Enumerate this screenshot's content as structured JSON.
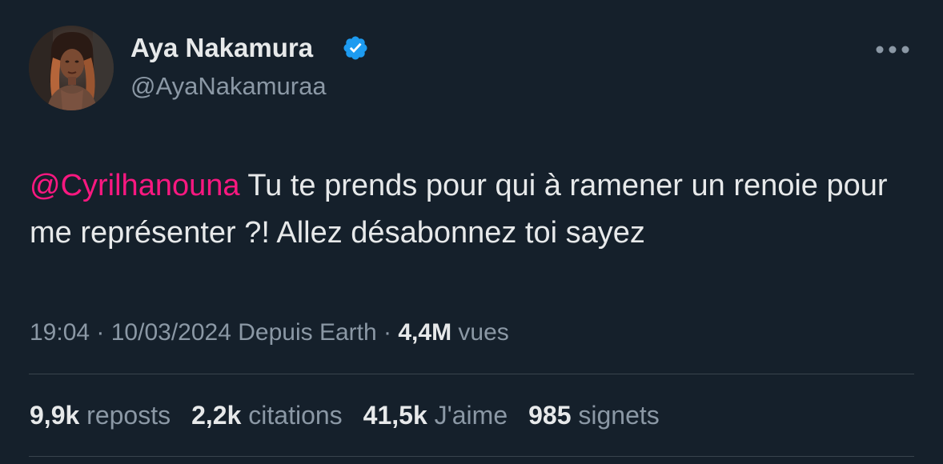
{
  "author": {
    "name": "Aya Nakamura",
    "handle": "@AyaNakamuraa",
    "verified": true,
    "verified_color": "#1d9bf0"
  },
  "tweet": {
    "mention": "@Cyrilhanouna",
    "text": " Tu te prends pour qui à ramener un renoie pour me représenter ?! Allez désabonnez toi sayez",
    "mention_color": "#f91880"
  },
  "meta": {
    "time": "19:04",
    "sep1": " · ",
    "date": "10/03/2024",
    "source": "Depuis Earth",
    "sep2": " · ",
    "views_count": "4,4M",
    "views_label": "vues"
  },
  "stats": {
    "reposts": {
      "count": "9,9k",
      "label": "reposts"
    },
    "quotes": {
      "count": "2,2k",
      "label": "citations"
    },
    "likes": {
      "count": "41,5k",
      "label": "J'aime"
    },
    "bookmarks": {
      "count": "985",
      "label": "signets"
    }
  },
  "icons": {
    "more": "more-horizontal-icon",
    "verified": "verified-badge-icon"
  },
  "colors": {
    "background": "#15202b",
    "text_primary": "#e7e9ea",
    "text_secondary": "#8b98a5",
    "divider": "#38444d"
  }
}
